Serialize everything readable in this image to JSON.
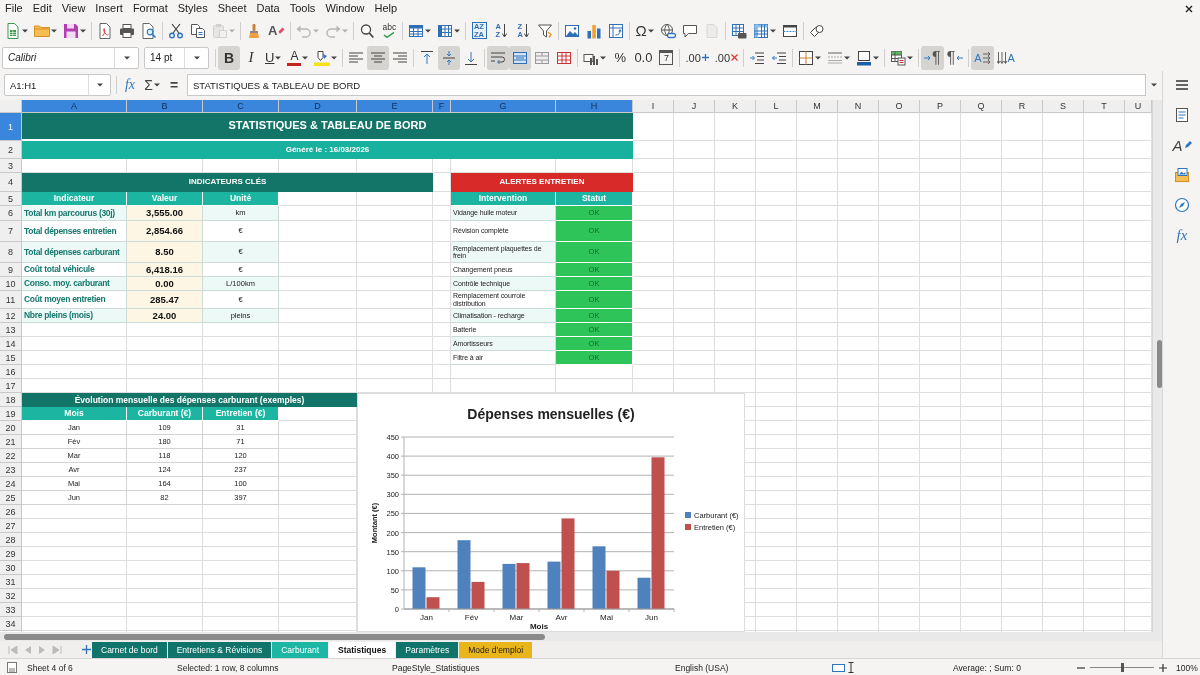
{
  "menu_bar": {
    "items": [
      "File",
      "Edit",
      "View",
      "Insert",
      "Format",
      "Styles",
      "Sheet",
      "Data",
      "Tools",
      "Window",
      "Help"
    ]
  },
  "standard_toolbar": [
    {
      "disabled": false
    },
    {
      "disabled": false
    },
    {
      "disabled": false
    },
    {
      "disabled": false
    },
    {
      "disabled": false
    },
    {
      "disabled": false
    },
    {
      "disabled": false
    },
    {
      "disabled": false
    },
    {
      "disabled": true
    },
    {
      "disabled": false
    },
    {
      "glyph": "A",
      "disabled": false
    },
    {
      "disabled": true
    },
    {
      "disabled": true
    },
    {
      "disabled": false
    },
    {
      "glyph": "abc",
      "disabled": false
    },
    {
      "disabled": false
    },
    {
      "disabled": false
    },
    {
      "glyph": "AZZA",
      "disabled": false
    },
    {
      "glyph": "AZ",
      "disabled": false
    },
    {
      "glyph": "ZA",
      "disabled": false
    },
    {
      "disabled": false
    },
    {
      "disabled": false
    },
    {
      "disabled": false
    },
    {
      "disabled": false
    },
    {
      "glyph": "Ω",
      "disabled": false
    },
    {
      "disabled": false
    },
    {
      "disabled": false
    },
    {
      "disabled": true
    },
    {
      "disabled": false
    },
    {
      "disabled": false
    },
    {
      "disabled": false
    },
    {
      "disabled": false
    }
  ],
  "formatting_toolbar": {
    "font_name": "Calibri",
    "font_size": "14 pt",
    "buttons": [
      {
        "glyph": "B",
        "on": true
      },
      {
        "glyph": "I",
        "on": false
      },
      {
        "glyph": "U",
        "on": false
      },
      {
        "glyph": "A",
        "on": false
      },
      {
        "on": false
      },
      {
        "on": false
      },
      {
        "on": true
      },
      {
        "on": false
      },
      {
        "on": false
      },
      {
        "on": true
      },
      {
        "on": false
      },
      {
        "on": true
      },
      {
        "on": true
      },
      {
        "on": false
      },
      {
        "on": false
      },
      {
        "on": false
      },
      {
        "glyph": "%",
        "on": false
      },
      {
        "glyph": "0.0",
        "on": false
      },
      {
        "glyph": "7",
        "on": false
      },
      {
        "glyph": ".00",
        "on": false
      },
      {
        "glyph": ".00",
        "on": false
      },
      {
        "on": false
      },
      {
        "on": false
      },
      {
        "on": false
      },
      {
        "on": false
      },
      {
        "on": false
      },
      {
        "on": false
      },
      {
        "glyph": "¶",
        "on": true
      },
      {
        "glyph": "¶",
        "on": false
      },
      {
        "glyph": "A",
        "on": true
      },
      {
        "glyph": "A",
        "on": false
      }
    ]
  },
  "formula_bar": {
    "name_box": "A1:H1",
    "function_wizard": "fx",
    "sum": "Σ",
    "equals": "=",
    "content": "STATISTIQUES & TABLEAU DE BORD"
  },
  "sidebar": {
    "buttons": [
      {
        "selected": false
      },
      {
        "glyph": "A",
        "selected": false
      },
      {
        "selected": false
      },
      {
        "selected": false
      },
      {
        "glyph": "fx",
        "selected": false
      }
    ]
  },
  "sheet": {
    "columns": [
      {
        "label": "A",
        "selected": true
      },
      {
        "label": "B",
        "selected": true
      },
      {
        "label": "C",
        "selected": true
      },
      {
        "label": "D",
        "selected": true
      },
      {
        "label": "E",
        "selected": true
      },
      {
        "label": "F",
        "selected": true
      },
      {
        "label": "G",
        "selected": true
      },
      {
        "label": "H",
        "selected": true
      },
      {
        "label": "I",
        "selected": false
      },
      {
        "label": "J",
        "selected": false
      },
      {
        "label": "K",
        "selected": false
      },
      {
        "label": "L",
        "selected": false
      },
      {
        "label": "M",
        "selected": false
      },
      {
        "label": "N",
        "selected": false
      },
      {
        "label": "O",
        "selected": false
      },
      {
        "label": "P",
        "selected": false
      },
      {
        "label": "Q",
        "selected": false
      },
      {
        "label": "R",
        "selected": false
      },
      {
        "label": "S",
        "selected": false
      },
      {
        "label": "T",
        "selected": false
      },
      {
        "label": "U",
        "selected": false
      }
    ],
    "rows": [
      {
        "label": "1",
        "selected": true
      },
      {
        "label": "2",
        "selected": false
      },
      {
        "label": "3",
        "selected": false
      },
      {
        "label": "4",
        "selected": false
      },
      {
        "label": "5",
        "selected": false
      },
      {
        "label": "6",
        "selected": false
      },
      {
        "label": "7",
        "selected": false
      },
      {
        "label": "8",
        "selected": false
      },
      {
        "label": "9",
        "selected": false
      },
      {
        "label": "10",
        "selected": false
      },
      {
        "label": "11",
        "selected": false
      },
      {
        "label": "12",
        "selected": false
      },
      {
        "label": "13",
        "selected": false
      },
      {
        "label": "14",
        "selected": false
      },
      {
        "label": "15",
        "selected": false
      },
      {
        "label": "16",
        "selected": false
      },
      {
        "label": "17",
        "selected": false
      },
      {
        "label": "18",
        "selected": false
      },
      {
        "label": "19",
        "selected": false
      },
      {
        "label": "20",
        "selected": false
      },
      {
        "label": "21",
        "selected": false
      },
      {
        "label": "22",
        "selected": false
      },
      {
        "label": "23",
        "selected": false
      },
      {
        "label": "24",
        "selected": false
      },
      {
        "label": "25",
        "selected": false
      },
      {
        "label": "26",
        "selected": false
      },
      {
        "label": "27",
        "selected": false
      },
      {
        "label": "28",
        "selected": false
      },
      {
        "label": "29",
        "selected": false
      },
      {
        "label": "30",
        "selected": false
      },
      {
        "label": "31",
        "selected": false
      },
      {
        "label": "32",
        "selected": false
      },
      {
        "label": "33",
        "selected": false
      },
      {
        "label": "34",
        "selected": false
      }
    ],
    "title": "STATISTIQUES & TABLEAU DE BORD",
    "subtitle": "Généré le : 16/03/2026",
    "indicators": {
      "title": "INDICATEURS CLÉS",
      "columns": [
        "Indicateur",
        "Valeur",
        "Unité"
      ],
      "rows": [
        {
          "indicator": "Total km parcourus (30j)",
          "value": "3,555.00",
          "unit": "km"
        },
        {
          "indicator": "Total dépenses entretien",
          "value": "2,854.66",
          "unit": "€"
        },
        {
          "indicator": "Total dépenses carburant",
          "value": "8.50",
          "unit": "€"
        },
        {
          "indicator": "Coût total véhicule",
          "value": "6,418.16",
          "unit": "€"
        },
        {
          "indicator": "Conso. moy. carburant",
          "value": "0.00",
          "unit": "L/100km"
        },
        {
          "indicator": "Coût moyen entretien",
          "value": "285.47",
          "unit": "€"
        },
        {
          "indicator": "Nbre pleins (mois)",
          "value": "24.00",
          "unit": "pleins"
        }
      ]
    },
    "alerts": {
      "title": "ALERTES ENTRETIEN",
      "columns": [
        "Intervention",
        "Statut"
      ],
      "rows": [
        {
          "intervention": "Vidange huile moteur",
          "status": "OK"
        },
        {
          "intervention": "Révision complète",
          "status": "OK"
        },
        {
          "intervention": "Remplacement plaquettes de frein",
          "status": "OK"
        },
        {
          "intervention": "Changement pneus",
          "status": "OK"
        },
        {
          "intervention": "Contrôle technique",
          "status": "OK"
        },
        {
          "intervention": "Remplacement courroie distribution",
          "status": "OK"
        },
        {
          "intervention": "Climatisation - recharge",
          "status": "OK"
        },
        {
          "intervention": "Batterie",
          "status": "OK"
        },
        {
          "intervention": "Amortisseurs",
          "status": "OK"
        },
        {
          "intervention": "Filtre à air",
          "status": "OK"
        }
      ]
    },
    "monthly": {
      "title": "Évolution mensuelle des dépenses carburant (exemples)",
      "columns": [
        "Mois",
        "Carburant (€)",
        "Entretien (€)"
      ],
      "rows": [
        {
          "month": "Jan",
          "fuel": "109",
          "maintenance": "31"
        },
        {
          "month": "Fév",
          "fuel": "180",
          "maintenance": "71"
        },
        {
          "month": "Mar",
          "fuel": "118",
          "maintenance": "120"
        },
        {
          "month": "Avr",
          "fuel": "124",
          "maintenance": "237"
        },
        {
          "month": "Mai",
          "fuel": "164",
          "maintenance": "100"
        },
        {
          "month": "Jun",
          "fuel": "82",
          "maintenance": "397"
        }
      ]
    },
    "chart_data": {
      "type": "bar",
      "title": "Dépenses mensuelles (€)",
      "xlabel": "Mois",
      "ylabel": "Montant (€)",
      "categories": [
        "Jan",
        "Fév",
        "Mar",
        "Avr",
        "Mai",
        "Jun"
      ],
      "series": [
        {
          "name": "Carburant (€)",
          "color": "#4f81bd",
          "values": [
            109,
            180,
            118,
            124,
            164,
            82
          ]
        },
        {
          "name": "Entretien (€)",
          "color": "#c0504d",
          "values": [
            31,
            71,
            120,
            237,
            100,
            397
          ]
        }
      ],
      "ylim": [
        0,
        450
      ],
      "yticks": [
        0,
        50,
        100,
        150,
        200,
        250,
        300,
        350,
        400,
        450
      ],
      "grid": true,
      "legend": "right"
    }
  },
  "sheet_tabs": {
    "tabs": [
      {
        "label": "Carnet de bord",
        "selected": false,
        "color": "#10746a"
      },
      {
        "label": "Entretiens & Révisions",
        "selected": false,
        "color": "#10746a"
      },
      {
        "label": "Carburant",
        "selected": false,
        "color": "#1cb6a5"
      },
      {
        "label": "Statistiques",
        "selected": true
      },
      {
        "label": "Paramètres",
        "selected": false,
        "color": "#10746a"
      },
      {
        "label": "Mode d'emploi",
        "selected": false,
        "color": "#e8b51a"
      }
    ]
  },
  "status_bar": {
    "sheet": "Sheet 4 of 6",
    "selection": "Selected: 1 row, 8 columns",
    "page_style": "PageStyle_Statistiques",
    "language": "English (USA)",
    "summary": "Average: ; Sum: 0",
    "zoom": {
      "level": 0.5,
      "reading": "100%"
    }
  }
}
